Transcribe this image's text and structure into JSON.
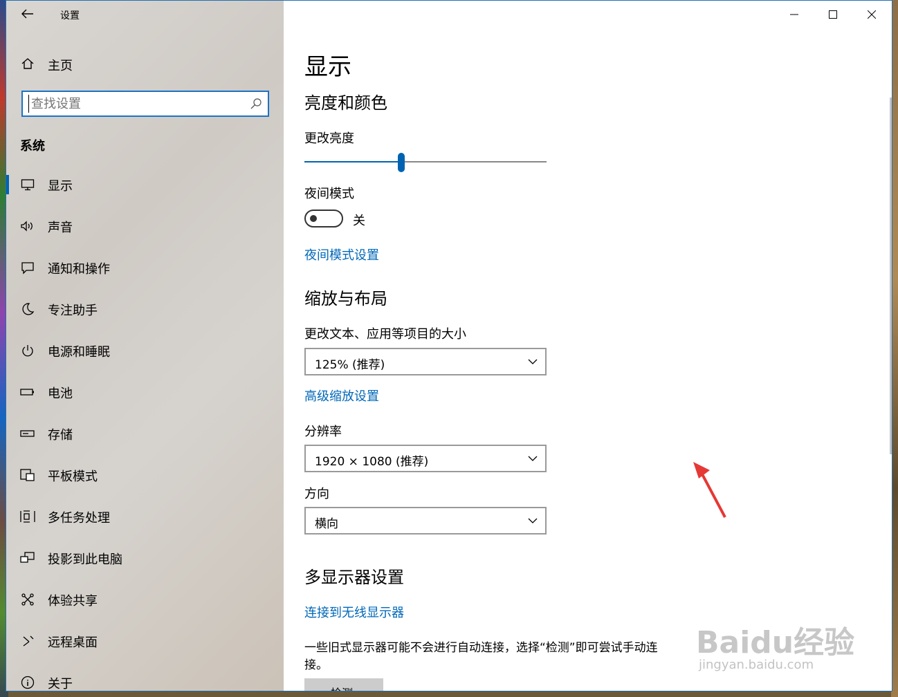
{
  "app": {
    "title": "设置"
  },
  "sidebar": {
    "home_label": "主页",
    "search_placeholder": "查找设置",
    "section_label": "系统",
    "items": [
      {
        "label": "显示",
        "icon": "monitor-icon",
        "selected": true
      },
      {
        "label": "声音",
        "icon": "speaker-icon"
      },
      {
        "label": "通知和操作",
        "icon": "notification-icon"
      },
      {
        "label": "专注助手",
        "icon": "moon-icon"
      },
      {
        "label": "电源和睡眠",
        "icon": "power-icon"
      },
      {
        "label": "电池",
        "icon": "battery-icon"
      },
      {
        "label": "存储",
        "icon": "storage-icon"
      },
      {
        "label": "平板模式",
        "icon": "tablet-icon"
      },
      {
        "label": "多任务处理",
        "icon": "multitask-icon"
      },
      {
        "label": "投影到此电脑",
        "icon": "project-icon"
      },
      {
        "label": "体验共享",
        "icon": "share-icon"
      },
      {
        "label": "远程桌面",
        "icon": "remote-icon"
      },
      {
        "label": "关于",
        "icon": "info-icon"
      }
    ]
  },
  "main": {
    "page_title": "显示",
    "brightness": {
      "heading": "亮度和颜色",
      "label": "更改亮度",
      "value_fraction": 0.4
    },
    "night_mode": {
      "label": "夜间模式",
      "state": "关",
      "on": false,
      "settings_link": "夜间模式设置"
    },
    "scale": {
      "heading": "缩放与布局",
      "size_label": "更改文本、应用等项目的大小",
      "size_value": "125% (推荐)",
      "advanced_link": "高级缩放设置",
      "resolution_label": "分辨率",
      "resolution_value": "1920 × 1080 (推荐)",
      "orientation_label": "方向",
      "orientation_value": "横向"
    },
    "multi_display": {
      "heading": "多显示器设置",
      "wireless_link": "连接到无线显示器",
      "description_line1": "一些旧式显示器可能不会进行自动连接，选择“检测”即可尝试手动连",
      "description_line2": "接。",
      "detect_label": "检测"
    }
  },
  "watermark": {
    "text": "Baidu经验",
    "subtext": "jingyan.baidu.com"
  },
  "colors": {
    "accent": "#0063b1",
    "link": "#0067b8",
    "annotation": "#e53935"
  }
}
